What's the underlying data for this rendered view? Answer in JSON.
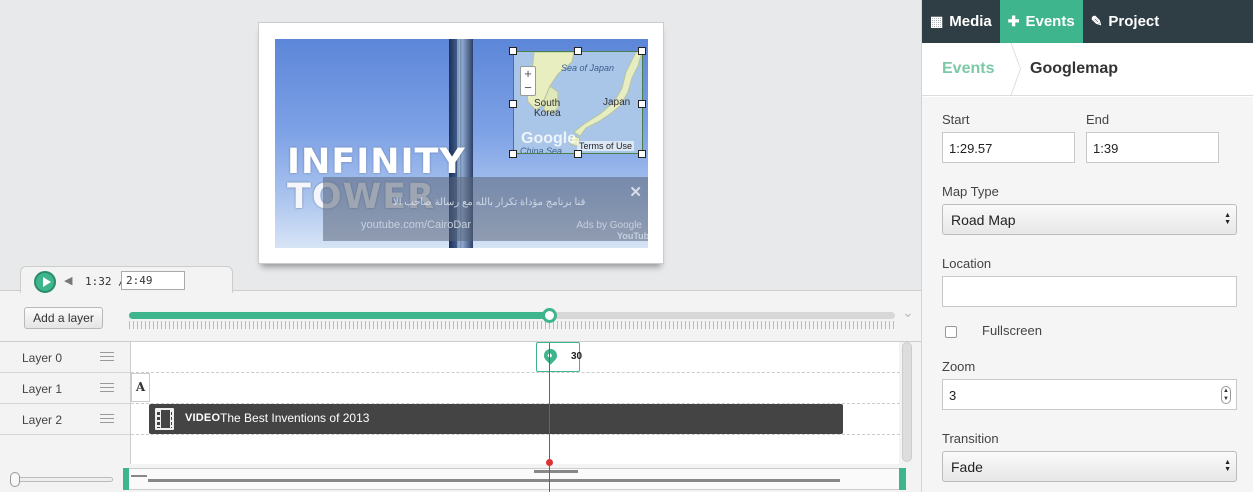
{
  "tabs": [
    {
      "label": "Media",
      "icon": "film-icon"
    },
    {
      "label": "Events",
      "icon": "plus-icon"
    },
    {
      "label": "Project",
      "icon": "edit-icon"
    }
  ],
  "breadcrumb": {
    "parent": "Events",
    "current": "Googlemap"
  },
  "form": {
    "start_label": "Start",
    "start_value": "1:29.57",
    "end_label": "End",
    "end_value": "1:39",
    "map_type_label": "Map Type",
    "map_type_value": "Road Map",
    "location_label": "Location",
    "location_value": "",
    "fullscreen_label": "Fullscreen",
    "fullscreen_checked": false,
    "zoom_label": "Zoom",
    "zoom_value": "3",
    "transition_label": "Transition",
    "transition_value": "Fade"
  },
  "preview": {
    "title_line1": "INFINITY",
    "title_line2": "TOWER",
    "ad_text": "قنا برنامج مؤداة تكرار بالله مع رسالة صاحب الا",
    "ad_url": "youtube.com/CairoDar",
    "ad_by": "Ads by Google",
    "yt_logo": "YouTube",
    "map": {
      "sea_of_japan": "Sea of Japan",
      "south_korea": "South Korea",
      "japan": "Japan",
      "east_china_sea": "China Sea",
      "google": "Google",
      "terms": "Terms of Use",
      "zoom_in": "+",
      "zoom_out": "−"
    }
  },
  "player": {
    "current_time": "1:32",
    "separator": "/",
    "duration": "2:49",
    "progress_fraction": 0.55
  },
  "timeline": {
    "add_layer_label": "Add a layer",
    "layers": [
      "Layer 0",
      "Layer 1",
      "Layer 2"
    ],
    "gmap_event_number": "30",
    "text_event_glyph": "A",
    "video_event": {
      "type": "VIDEO",
      "title": "The Best Inventions of 2013"
    }
  },
  "colors": {
    "accent": "#3fb58e",
    "dark_header": "#2e3e44",
    "playhead": "#dd3333"
  }
}
